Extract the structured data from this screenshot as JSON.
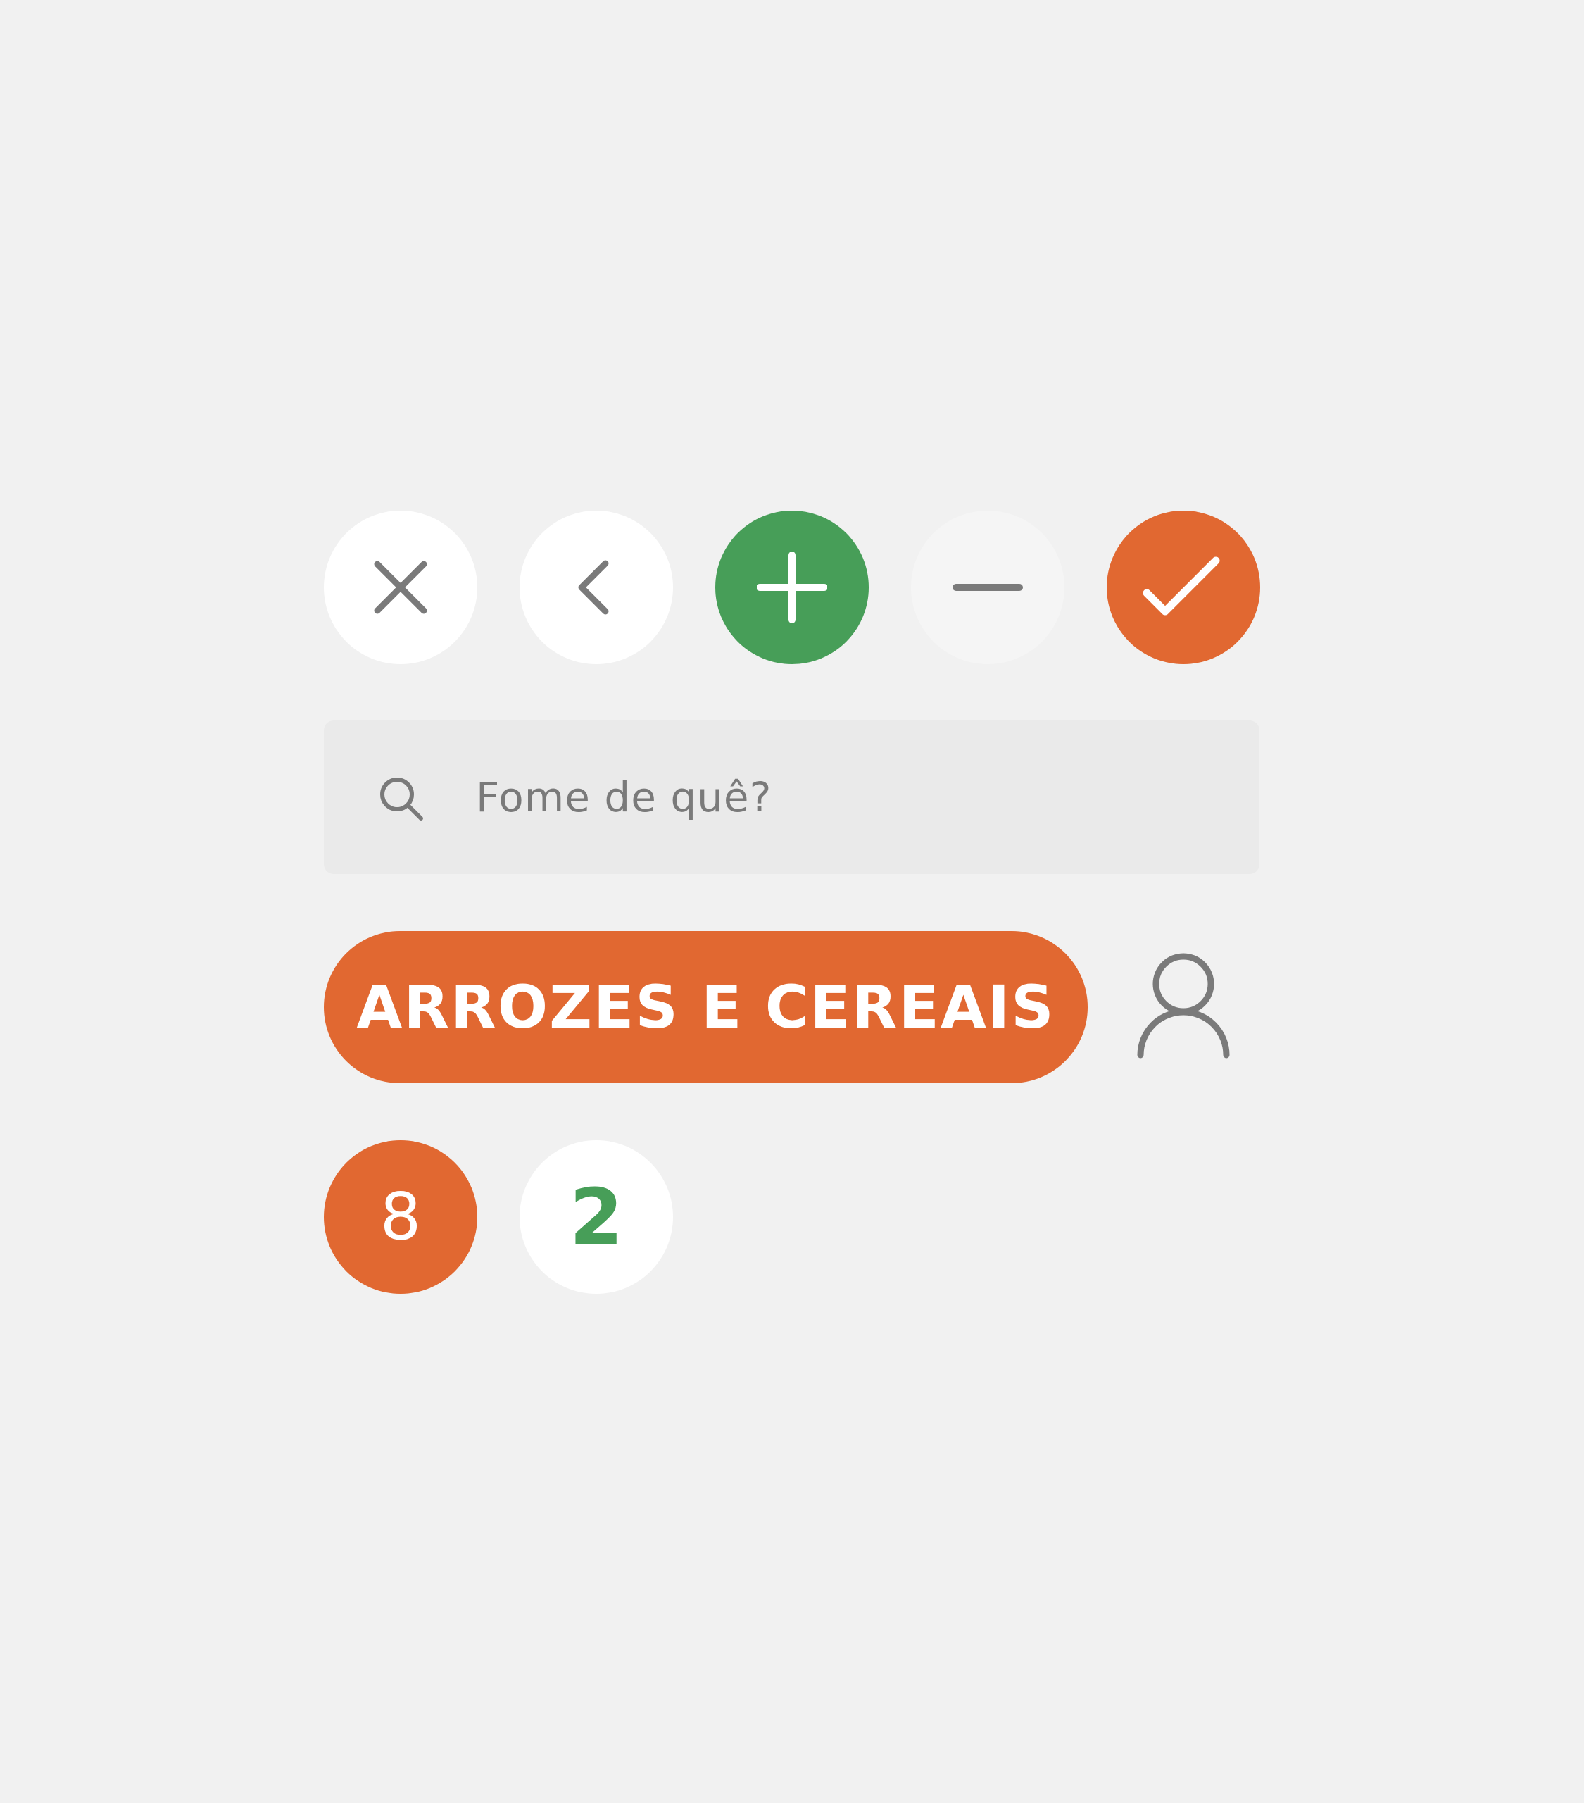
{
  "colors": {
    "background": "#f1f1f1",
    "orange": "#e16831",
    "green": "#479e58",
    "white": "#ffffff",
    "light": "#f5f5f5",
    "search_bg": "#eaeaea",
    "icon_gray": "#7a7a7a"
  },
  "icon_buttons": [
    {
      "name": "close",
      "icon": "close-icon",
      "background": "white"
    },
    {
      "name": "back",
      "icon": "chevron-left-icon",
      "background": "white"
    },
    {
      "name": "add",
      "icon": "plus-icon",
      "background": "green"
    },
    {
      "name": "remove",
      "icon": "minus-icon",
      "background": "light"
    },
    {
      "name": "confirm",
      "icon": "check-icon",
      "background": "orange"
    }
  ],
  "search": {
    "icon": "search-icon",
    "placeholder": "Fome de quê?"
  },
  "category": {
    "label": "ARROZES E CEREAIS"
  },
  "profile": {
    "icon": "user-icon"
  },
  "counters": [
    {
      "value": "8",
      "background": "orange"
    },
    {
      "value": "2",
      "background": "white"
    }
  ]
}
